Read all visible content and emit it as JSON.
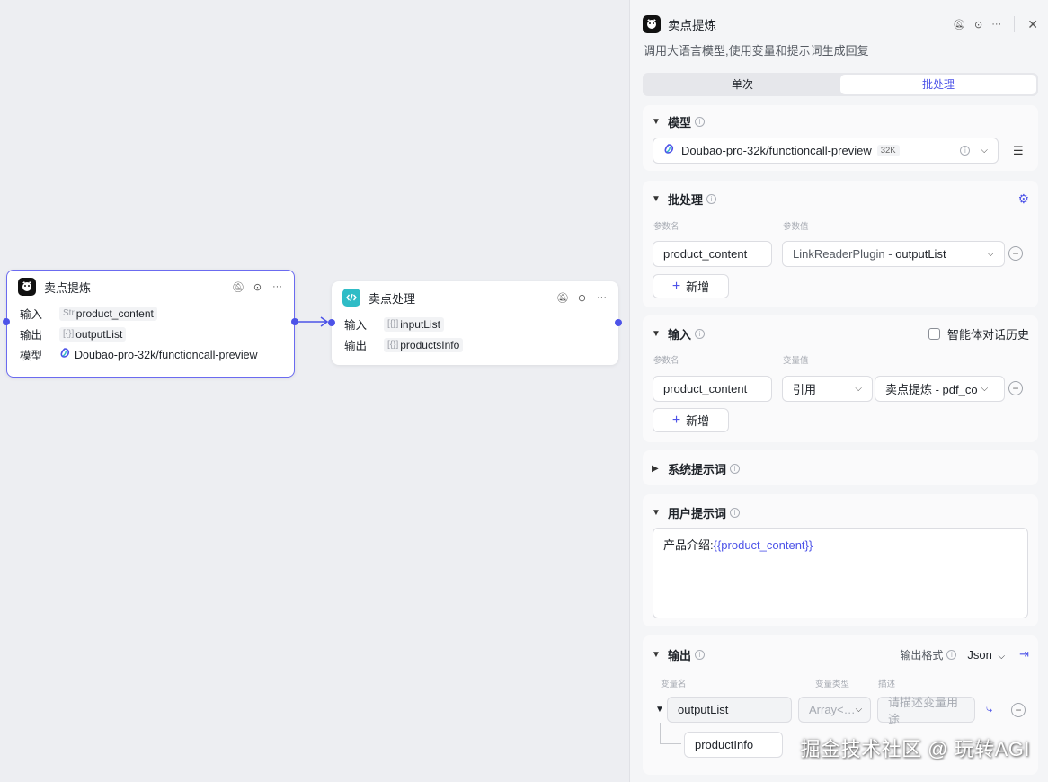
{
  "canvas": {
    "node1": {
      "title": "卖点提炼",
      "input_label": "输入",
      "input_type": "Str",
      "input_value": "product_content",
      "output_label": "输出",
      "output_type": "[{}]",
      "output_value": "outputList",
      "model_label": "模型",
      "model_value": "Doubao-pro-32k/functioncall-preview"
    },
    "node2": {
      "title": "卖点处理",
      "input_label": "输入",
      "input_type": "[{}]",
      "input_value": "inputList",
      "output_label": "输出",
      "output_type": "[{}]",
      "output_value": "productsInfo"
    }
  },
  "panel": {
    "title": "卖点提炼",
    "description": "调用大语言模型,使用变量和提示词生成回复",
    "tabs": {
      "single": "单次",
      "batch": "批处理"
    },
    "model": {
      "heading": "模型",
      "value": "Doubao-pro-32k/functioncall-preview",
      "badge": "32K"
    },
    "batch": {
      "heading": "批处理",
      "param_name_label": "参数名",
      "param_value_label": "参数值",
      "param_name": "product_content",
      "param_value_source": "LinkReaderPlugin",
      "param_value_sep": " - ",
      "param_value_field": "outputList",
      "add_label": "新增"
    },
    "input": {
      "heading": "输入",
      "history_label": "智能体对话历史",
      "param_name_label": "参数名",
      "var_value_label": "变量值",
      "param_name": "product_content",
      "ref_mode": "引用",
      "ref_value": "卖点提炼 - pdf_co",
      "add_label": "新增"
    },
    "system_prompt": {
      "heading": "系统提示词"
    },
    "user_prompt": {
      "heading": "用户提示词",
      "text_prefix": "产品介绍:",
      "text_var": "{{product_content}}"
    },
    "output": {
      "heading": "输出",
      "format_label": "输出格式",
      "format_value": "Json",
      "var_name_label": "变量名",
      "var_type_label": "变量类型",
      "desc_label": "描述",
      "var_name": "outputList",
      "var_type": "Array<…",
      "desc_placeholder": "请描述变量用途",
      "child_name": "productInfo"
    }
  },
  "watermark": "掘金技术社区 @ 玩转AGI",
  "colors": {
    "accent": "#4d53e8",
    "canvas_bg": "#edeef2",
    "panel_bg": "#f4f5f7"
  }
}
